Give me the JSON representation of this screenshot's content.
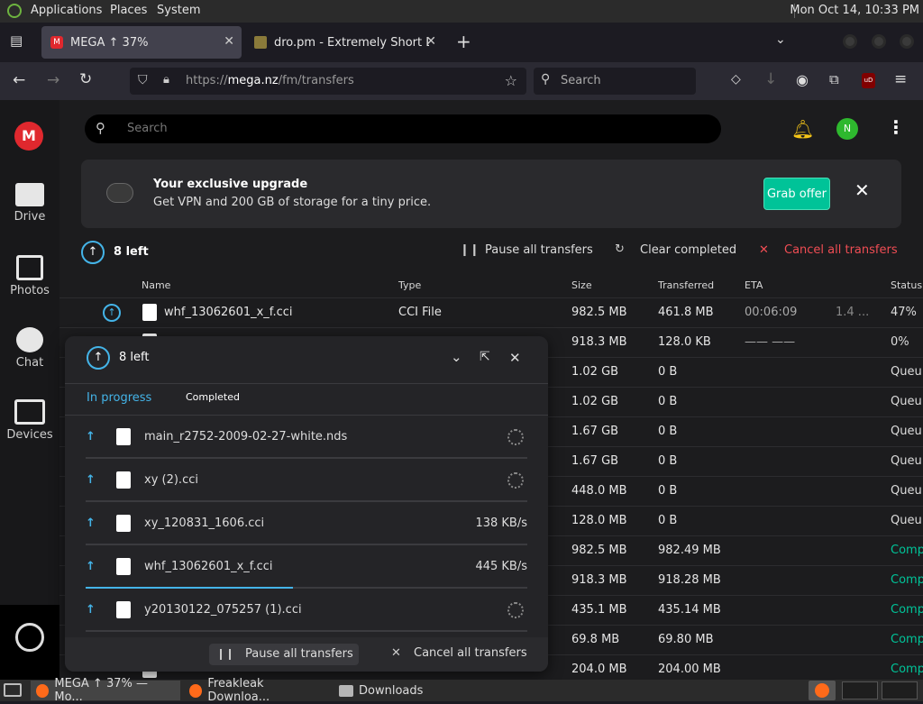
{
  "system": {
    "menus": [
      "Applications",
      "Places",
      "System"
    ],
    "clock": "Mon Oct 14, 10:33 PM"
  },
  "tabs": [
    {
      "label": "MEGA ↑ 37%"
    },
    {
      "label": "dro.pm - Extremely Short Li"
    }
  ],
  "nav": {
    "url_prefix": "https://",
    "url_domain": "mega.nz",
    "url_path": "/fm/transfers",
    "search_placeholder": "Search"
  },
  "sidebar": {
    "items": [
      {
        "label": "Drive"
      },
      {
        "label": "Photos"
      },
      {
        "label": "Chat"
      },
      {
        "label": "Devices"
      }
    ]
  },
  "main": {
    "search_placeholder": "Search",
    "avatar_initial": "N",
    "banner": {
      "title": "Your exclusive upgrade",
      "text": "Get VPN and 200 GB of storage for a tiny price.",
      "button": "Grab offer"
    },
    "transfers_bar": {
      "left_count": "8 left",
      "pause": "Pause all transfers",
      "clear": "Clear completed",
      "cancel": "Cancel all transfers"
    },
    "columns": [
      "Name",
      "Type",
      "Size",
      "Transferred",
      "ETA",
      "Status"
    ],
    "rows": [
      {
        "name": "whf_13062601_x_f.cci",
        "type": "CCI File",
        "size": "982.5 MB",
        "transferred": "461.8 MB",
        "eta": "00:06:09",
        "speed": "1.4 ...",
        "status": "47%"
      },
      {
        "name": "",
        "type": "",
        "size": "918.3 MB",
        "transferred": "128.0 KB",
        "eta": "—— ——",
        "speed": "",
        "status": "0%"
      },
      {
        "name": "",
        "type": "",
        "size": "1.02 GB",
        "transferred": "0 B",
        "eta": "",
        "speed": "",
        "status": "Queu"
      },
      {
        "name": "",
        "type": "",
        "size": "1.02 GB",
        "transferred": "0 B",
        "eta": "",
        "speed": "",
        "status": "Queu"
      },
      {
        "name": "",
        "type": "",
        "size": "1.67 GB",
        "transferred": "0 B",
        "eta": "",
        "speed": "",
        "status": "Queu"
      },
      {
        "name": "",
        "type": "",
        "size": "1.67 GB",
        "transferred": "0 B",
        "eta": "",
        "speed": "",
        "status": "Queu"
      },
      {
        "name": "",
        "type": "",
        "size": "448.0 MB",
        "transferred": "0 B",
        "eta": "",
        "speed": "",
        "status": "Queu"
      },
      {
        "name": "",
        "type": "",
        "size": "128.0 MB",
        "transferred": "0 B",
        "eta": "",
        "speed": "",
        "status": "Queu"
      },
      {
        "name": "",
        "type": "",
        "size": "982.5 MB",
        "transferred": "982.49 MB",
        "eta": "",
        "speed": "",
        "status": "Comp"
      },
      {
        "name": "",
        "type": "",
        "size": "918.3 MB",
        "transferred": "918.28 MB",
        "eta": "",
        "speed": "",
        "status": "Comp"
      },
      {
        "name": "",
        "type": "",
        "size": "435.1 MB",
        "transferred": "435.14 MB",
        "eta": "",
        "speed": "",
        "status": "Comp"
      },
      {
        "name": "",
        "type": "",
        "size": "69.8 MB",
        "transferred": "69.80 MB",
        "eta": "",
        "speed": "",
        "status": "Comp"
      },
      {
        "name": "",
        "type": "",
        "size": "204.0 MB",
        "transferred": "204.00 MB",
        "eta": "",
        "speed": "",
        "status": "Comp"
      }
    ]
  },
  "overlay": {
    "left_count": "8 left",
    "tab_in_progress": "In progress",
    "tab_completed": "Completed",
    "items": [
      {
        "name": "main_r2752-2009-02-27-white.nds",
        "speed": ""
      },
      {
        "name": "xy (2).cci",
        "speed": ""
      },
      {
        "name": "xy_120831_1606.cci",
        "speed": "138 KB/s"
      },
      {
        "name": "whf_13062601_x_f.cci",
        "speed": "445 KB/s",
        "progress": 0.47
      },
      {
        "name": "y20130122_075257 (1).cci",
        "speed": ""
      }
    ],
    "pause": "Pause all transfers",
    "cancel": "Cancel all transfers"
  },
  "taskbar": {
    "items": [
      {
        "label": "MEGA ↑ 37% — Mo..."
      },
      {
        "label": "Freakleak Downloa..."
      },
      {
        "label": "Downloads"
      }
    ]
  },
  "colors": {
    "accent": "#44b4e8",
    "mega_red": "#e0282e",
    "green": "#00c398",
    "danger": "#f04d54"
  }
}
